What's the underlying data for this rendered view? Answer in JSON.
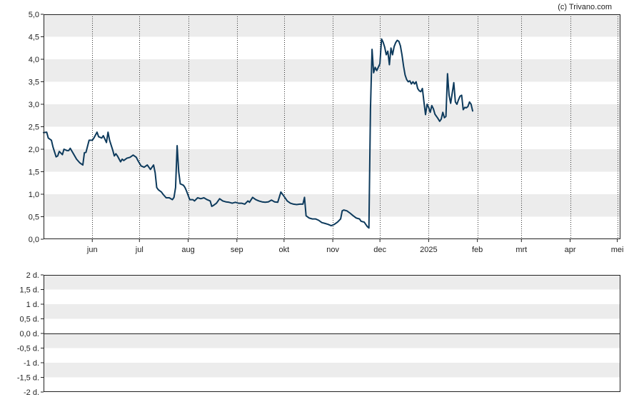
{
  "chart_data": [
    {
      "type": "line",
      "title": "",
      "copyright": "(c) Trivano.com",
      "xlabel": "",
      "ylabel": "",
      "ylim": [
        0,
        5
      ],
      "y_ticks": [
        "0,0",
        "0,5",
        "1,0",
        "1,5",
        "2,0",
        "2,5",
        "3,0",
        "3,5",
        "4,0",
        "4,5",
        "5,0"
      ],
      "x_ticks": [
        {
          "label": "jun",
          "day": 62
        },
        {
          "label": "jul",
          "day": 92
        },
        {
          "label": "aug",
          "day": 123
        },
        {
          "label": "sep",
          "day": 154
        },
        {
          "label": "okt",
          "day": 184
        },
        {
          "label": "nov",
          "day": 215
        },
        {
          "label": "dec",
          "day": 245
        },
        {
          "label": "2025",
          "day": 276
        },
        {
          "label": "feb",
          "day": 307
        },
        {
          "label": "mrt",
          "day": 335
        },
        {
          "label": "apr",
          "day": 366
        },
        {
          "label": "mei",
          "day": 396
        }
      ],
      "xlim": [
        31,
        398
      ],
      "series": [
        {
          "color": "#0d3a5c",
          "points": [
            [
              31,
              2.37
            ],
            [
              33,
              2.38
            ],
            [
              34,
              2.25
            ],
            [
              36,
              2.2
            ],
            [
              37,
              2.05
            ],
            [
              39,
              1.83
            ],
            [
              40,
              1.85
            ],
            [
              41,
              1.95
            ],
            [
              43,
              1.88
            ],
            [
              44,
              2.0
            ],
            [
              46,
              1.97
            ],
            [
              47,
              1.97
            ],
            [
              48,
              2.02
            ],
            [
              50,
              1.9
            ],
            [
              52,
              1.78
            ],
            [
              54,
              1.7
            ],
            [
              56,
              1.65
            ],
            [
              57,
              1.92
            ],
            [
              58,
              1.93
            ],
            [
              60,
              2.2
            ],
            [
              62,
              2.2
            ],
            [
              63,
              2.25
            ],
            [
              65,
              2.38
            ],
            [
              66,
              2.28
            ],
            [
              68,
              2.25
            ],
            [
              69,
              2.3
            ],
            [
              71,
              2.15
            ],
            [
              72,
              2.38
            ],
            [
              73,
              2.2
            ],
            [
              75,
              1.98
            ],
            [
              76,
              1.85
            ],
            [
              77,
              1.9
            ],
            [
              78,
              1.85
            ],
            [
              80,
              1.72
            ],
            [
              81,
              1.78
            ],
            [
              82,
              1.75
            ],
            [
              84,
              1.8
            ],
            [
              86,
              1.82
            ],
            [
              88,
              1.87
            ],
            [
              90,
              1.82
            ],
            [
              91,
              1.75
            ],
            [
              93,
              1.63
            ],
            [
              95,
              1.6
            ],
            [
              97,
              1.65
            ],
            [
              99,
              1.55
            ],
            [
              101,
              1.65
            ],
            [
              102,
              1.48
            ],
            [
              103,
              1.15
            ],
            [
              104,
              1.1
            ],
            [
              106,
              1.05
            ],
            [
              107,
              1.0
            ],
            [
              109,
              0.92
            ],
            [
              111,
              0.92
            ],
            [
              113,
              0.88
            ],
            [
              114,
              0.93
            ],
            [
              115,
              1.15
            ],
            [
              116,
              2.08
            ],
            [
              117,
              1.5
            ],
            [
              118,
              1.23
            ],
            [
              120,
              1.2
            ],
            [
              121,
              1.15
            ],
            [
              122,
              1.07
            ],
            [
              124,
              0.88
            ],
            [
              126,
              0.88
            ],
            [
              127,
              0.85
            ],
            [
              129,
              0.92
            ],
            [
              131,
              0.9
            ],
            [
              133,
              0.92
            ],
            [
              135,
              0.88
            ],
            [
              137,
              0.85
            ],
            [
              138,
              0.73
            ],
            [
              139,
              0.75
            ],
            [
              141,
              0.8
            ],
            [
              143,
              0.9
            ],
            [
              145,
              0.85
            ],
            [
              147,
              0.83
            ],
            [
              149,
              0.82
            ],
            [
              151,
              0.8
            ],
            [
              153,
              0.82
            ],
            [
              155,
              0.8
            ],
            [
              157,
              0.8
            ],
            [
              159,
              0.78
            ],
            [
              161,
              0.85
            ],
            [
              162,
              0.82
            ],
            [
              164,
              0.93
            ],
            [
              166,
              0.88
            ],
            [
              168,
              0.85
            ],
            [
              170,
              0.83
            ],
            [
              172,
              0.82
            ],
            [
              174,
              0.83
            ],
            [
              176,
              0.87
            ],
            [
              178,
              0.83
            ],
            [
              180,
              0.82
            ],
            [
              182,
              1.05
            ],
            [
              184,
              0.95
            ],
            [
              186,
              0.85
            ],
            [
              188,
              0.8
            ],
            [
              190,
              0.78
            ],
            [
              192,
              0.77
            ],
            [
              194,
              0.78
            ],
            [
              196,
              0.78
            ],
            [
              197,
              0.93
            ],
            [
              198,
              0.52
            ],
            [
              200,
              0.47
            ],
            [
              202,
              0.45
            ],
            [
              204,
              0.45
            ],
            [
              206,
              0.42
            ],
            [
              208,
              0.37
            ],
            [
              210,
              0.35
            ],
            [
              212,
              0.33
            ],
            [
              214,
              0.3
            ],
            [
              216,
              0.33
            ],
            [
              218,
              0.38
            ],
            [
              220,
              0.45
            ],
            [
              221,
              0.63
            ],
            [
              222,
              0.65
            ],
            [
              224,
              0.63
            ],
            [
              226,
              0.58
            ],
            [
              228,
              0.52
            ],
            [
              230,
              0.47
            ],
            [
              232,
              0.45
            ],
            [
              233,
              0.4
            ],
            [
              235,
              0.38
            ],
            [
              237,
              0.28
            ],
            [
              238,
              0.25
            ],
            [
              239,
              2.9
            ],
            [
              240,
              4.22
            ],
            [
              241,
              3.7
            ],
            [
              242,
              3.82
            ],
            [
              243,
              3.75
            ],
            [
              245,
              3.9
            ],
            [
              246,
              4.45
            ],
            [
              247,
              4.38
            ],
            [
              248,
              4.27
            ],
            [
              249,
              4.1
            ],
            [
              250,
              4.18
            ],
            [
              251,
              3.88
            ],
            [
              252,
              4.25
            ],
            [
              253,
              4.1
            ],
            [
              254,
              4.28
            ],
            [
              255,
              4.37
            ],
            [
              256,
              4.42
            ],
            [
              257,
              4.4
            ],
            [
              258,
              4.3
            ],
            [
              259,
              4.1
            ],
            [
              260,
              3.85
            ],
            [
              261,
              3.65
            ],
            [
              262,
              3.55
            ],
            [
              263,
              3.5
            ],
            [
              264,
              3.52
            ],
            [
              265,
              3.45
            ],
            [
              266,
              3.5
            ],
            [
              267,
              3.45
            ],
            [
              268,
              3.5
            ],
            [
              269,
              3.35
            ],
            [
              270,
              3.3
            ],
            [
              271,
              3.28
            ],
            [
              272,
              3.35
            ],
            [
              273,
              3.05
            ],
            [
              274,
              2.77
            ],
            [
              275,
              3.0
            ],
            [
              276,
              2.93
            ],
            [
              277,
              2.82
            ],
            [
              278,
              2.97
            ],
            [
              279,
              2.9
            ],
            [
              280,
              2.78
            ],
            [
              282,
              2.68
            ],
            [
              283,
              2.62
            ],
            [
              284,
              2.67
            ],
            [
              285,
              2.82
            ],
            [
              286,
              2.7
            ],
            [
              287,
              2.73
            ],
            [
              288,
              3.68
            ],
            [
              289,
              3.2
            ],
            [
              290,
              3.02
            ],
            [
              291,
              3.25
            ],
            [
              292,
              3.48
            ],
            [
              293,
              3.05
            ],
            [
              294,
              3.0
            ],
            [
              295,
              3.1
            ],
            [
              296,
              3.18
            ],
            [
              297,
              3.2
            ],
            [
              298,
              2.88
            ],
            [
              299,
              2.93
            ],
            [
              300,
              2.92
            ],
            [
              301,
              2.95
            ],
            [
              302,
              3.05
            ],
            [
              303,
              3.0
            ],
            [
              304,
              2.85
            ]
          ]
        }
      ]
    },
    {
      "type": "line",
      "title": "",
      "ylim": [
        -2,
        2
      ],
      "y_ticks": [
        "-2 d.",
        "-1,5 d.",
        "-1 d.",
        "-0,5 d.",
        "0,0 d.",
        "0,5 d.",
        "1 d.",
        "1,5 d.",
        "2 d."
      ],
      "series": []
    }
  ]
}
